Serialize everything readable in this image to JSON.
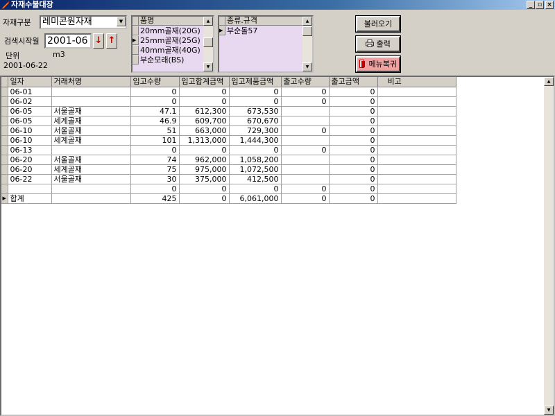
{
  "window": {
    "title": "자재수불대장",
    "min_label": "_",
    "restore_label": "▫",
    "close_label": "×"
  },
  "filters": {
    "category_label": "자재구분",
    "category_value": "레미콘원자재",
    "start_month_label": "검색시작월",
    "start_month_value": "2001-06",
    "unit_label": "단위",
    "unit_value": "m3",
    "date_value": "2001-06-22",
    "down_arrow": "↓",
    "up_arrow": "↑"
  },
  "product_list": {
    "header": "품명",
    "items": [
      "20mm골재(20G)",
      "25mm골재(25G)",
      "40mm골재(40G)",
      "부순모래(BS)"
    ],
    "selected_index": 1
  },
  "spec_list": {
    "header": "종류.규격",
    "items": [
      "부순돌57"
    ],
    "selected_index": 0
  },
  "buttons": {
    "load": "불러오기",
    "print": "출력",
    "menu": "메뉴복귀"
  },
  "table": {
    "columns": [
      "일자",
      "거래처명",
      "입고수량",
      "입고합계금액",
      "입고제품금액",
      "출고수량",
      "출고금액",
      "비고"
    ],
    "rows": [
      [
        "06-01",
        "",
        "0",
        "0",
        "0",
        "0",
        "0",
        ""
      ],
      [
        "06-02",
        "",
        "0",
        "0",
        "0",
        "0",
        "0",
        ""
      ],
      [
        "06-05",
        "서울골재",
        "47.1",
        "612,300",
        "673,530",
        "",
        "0",
        ""
      ],
      [
        "06-05",
        "세계골재",
        "46.9",
        "609,700",
        "670,670",
        "",
        "0",
        ""
      ],
      [
        "06-10",
        "서울골재",
        "51",
        "663,000",
        "729,300",
        "0",
        "0",
        ""
      ],
      [
        "06-10",
        "세계골재",
        "101",
        "1,313,000",
        "1,444,300",
        "",
        "0",
        ""
      ],
      [
        "06-13",
        "",
        "0",
        "0",
        "0",
        "0",
        "0",
        ""
      ],
      [
        "06-20",
        "서울골재",
        "74",
        "962,000",
        "1,058,200",
        "",
        "0",
        ""
      ],
      [
        "06-20",
        "세계골재",
        "75",
        "975,000",
        "1,072,500",
        "",
        "0",
        ""
      ],
      [
        "06-22",
        "서울골재",
        "30",
        "375,000",
        "412,500",
        "",
        "0",
        ""
      ],
      [
        "",
        "",
        "0",
        "0",
        "0",
        "0",
        "0",
        ""
      ],
      [
        "합계",
        "",
        "425",
        "0",
        "6,061,000",
        "0",
        "0",
        ""
      ]
    ],
    "current_row_index": 11
  }
}
